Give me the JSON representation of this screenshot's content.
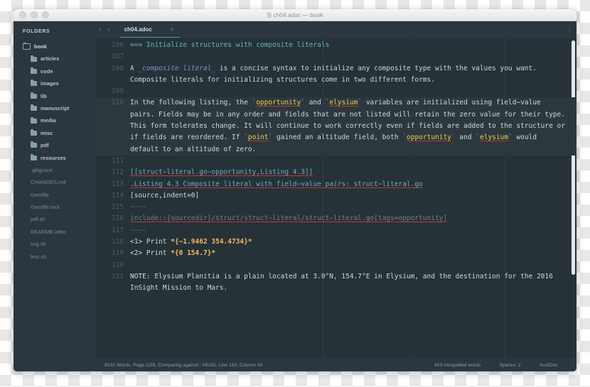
{
  "window": {
    "title": "ch04.adoc — book",
    "traffic_lights": [
      "close",
      "minimize",
      "zoom"
    ]
  },
  "sidebar": {
    "header": "FOLDERS",
    "root": {
      "label": "book",
      "icon": "folder-open-icon"
    },
    "folders": [
      {
        "label": "articles",
        "icon": "folder-icon"
      },
      {
        "label": "code",
        "icon": "folder-icon"
      },
      {
        "label": "images",
        "icon": "folder-icon"
      },
      {
        "label": "lib",
        "icon": "folder-icon"
      },
      {
        "label": "manuscript",
        "icon": "folder-icon"
      },
      {
        "label": "media",
        "icon": "folder-icon"
      },
      {
        "label": "misc",
        "icon": "folder-icon"
      },
      {
        "label": "pdf",
        "icon": "folder-icon"
      },
      {
        "label": "resources",
        "icon": "folder-icon"
      }
    ],
    "files": [
      {
        "label": ".gitignore"
      },
      {
        "label": "CHANGES.md"
      },
      {
        "label": "Gemfile"
      },
      {
        "label": "Gemfile.lock"
      },
      {
        "label": "pdf.sh"
      },
      {
        "label": "README.adoc"
      },
      {
        "label": "svg.sh"
      },
      {
        "label": "test.sh"
      }
    ]
  },
  "tabbar": {
    "back": "‹",
    "forward": "›",
    "tab_label": "ch04.adoc",
    "close": "×",
    "menu": "kebab-menu"
  },
  "editor": {
    "first_line": 106,
    "lines": [
      {
        "num": "106"
      },
      {
        "num": "107"
      },
      {
        "num": "108"
      },
      {
        "num": "109"
      },
      {
        "num": "110"
      },
      {
        "num": "111"
      },
      {
        "num": "112"
      },
      {
        "num": "113"
      },
      {
        "num": "114"
      },
      {
        "num": "115"
      },
      {
        "num": "116"
      },
      {
        "num": "117"
      },
      {
        "num": "118"
      },
      {
        "num": "119"
      },
      {
        "num": "120"
      },
      {
        "num": "121"
      }
    ],
    "text": {
      "l106_marker": "===",
      "l106_title": " Initialize structures with composite literals",
      "l108_a": "A ",
      "l108_em": "_composite literal_",
      "l108_rest": " is a concise syntax to initialize any composite type with the values you want. Composite literals for initializing structures come in two different forms.",
      "l110_p1": "In the following listing, the ",
      "l110_w1": "opportunity",
      "l110_p2": " and ",
      "l110_w2": "elysium",
      "l110_p3": " variables are initialized using field−value pairs. Fields may be in any order and fields that are not listed will retain the zero value for their type. This form tolerates change. It will continue to work correctly even if fields are added to the structure or if fields are reordered. If ",
      "l110_w3": "point",
      "l110_p4": " gained an altitude field, both ",
      "l110_w4": "opportunity",
      "l110_p5": " and ",
      "l110_w5": "elysium",
      "l110_p6": " would default to an altitude of zero.",
      "l112": "[[struct−literal.go−opportunity,Listing 4.3]]",
      "l113": ".Listing 4.3 Composite literal with field−value pairs: struct−literal.go",
      "l114": "[source,indent=0]",
      "l115": "−−−−",
      "l116": "include::{sourcedir}/struct/struct−literal/struct−literal.go[tags=opportunity]",
      "l117": "−−−−",
      "l118_pre": "<1> Print ",
      "l118_bold": "*{−1.9462 354.4734}*",
      "l119_pre": "<2> Print ",
      "l119_bold": "*{0 154.7}*",
      "l121": "NOTE: Elysium Planitia is a plain located at 3.0°N, 154.7°E in Elysium, and the destination for the 2016 InSight Mission to Mars."
    }
  },
  "statusbar": {
    "left": "8233 Words, Page 1/28, Comparing against : HEAD, Line 110, Column 43",
    "misspelled": "423 misspelled words",
    "spaces": "Spaces: 2",
    "grammar": "AsciiDoc"
  },
  "colors": {
    "window_bg": "#2b3640",
    "editor_bg": "#263238",
    "accent_tab": "#4f9a94",
    "heading_cyan": "#5fb6c4",
    "inline_code_yellow": "#e8d44d",
    "bold_orange": "#f3b963",
    "italic_blue": "#7e8fd6",
    "spell_underline": "#c0392b",
    "gutter": "#4d5c63",
    "text": "#cfd8dc"
  }
}
